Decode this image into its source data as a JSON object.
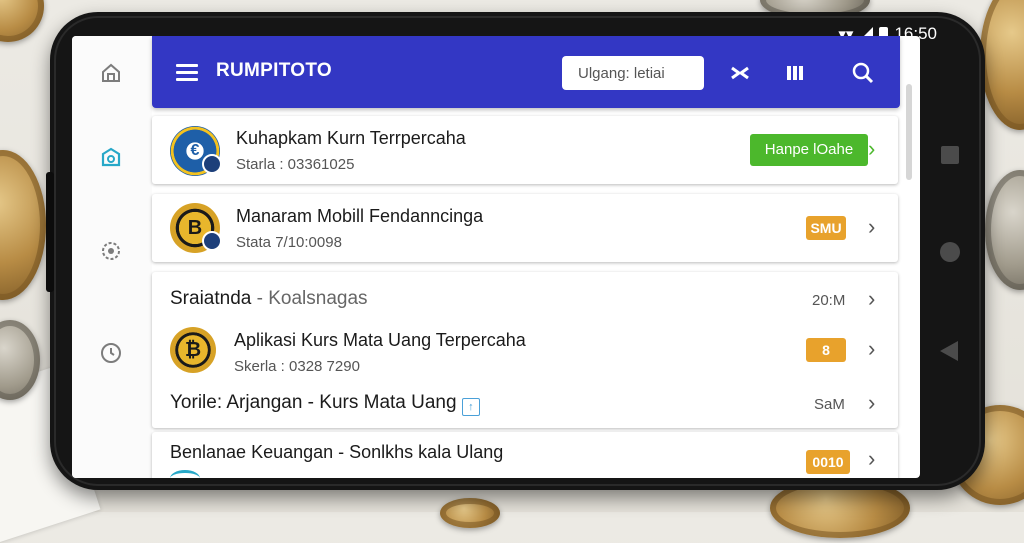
{
  "status_bar": {
    "time": "16:50"
  },
  "app_bar": {
    "title": "RUMPITOTO",
    "search_value": "Ulgang: letiai"
  },
  "items": [
    {
      "title": "Kuhapkam Kurn Terrpercaha",
      "subtitle": "Starla : 03361025",
      "action_label": "Hanpe lOahe"
    },
    {
      "title": "Manaram Mobill Fendanncinga",
      "subtitle": "Stata 7/10:0098",
      "badge": "SMU"
    }
  ],
  "section": {
    "title": "Sraiatnda",
    "subtitle": "Koalsnagas",
    "meta": "20:M",
    "rows": [
      {
        "title": "Aplikasi Kurs Mata Uang Terpercaha",
        "subtitle": "Skerla : 0328 7290",
        "badge": "8"
      },
      {
        "title": "Yorile: Arjangan - Kurs Mata Uang",
        "meta": "SaM"
      }
    ]
  },
  "last_item": {
    "title": "Benlanae Keuangan - Sonlkhs kala Ulang",
    "badge": "0010"
  },
  "colors": {
    "app_bar": "#3337c4",
    "action_green": "#4cb82c",
    "badge_orange": "#e8a22c",
    "rail_active": "#27a8c8"
  },
  "icons": {
    "rail": [
      "home-icon",
      "camera-icon",
      "settings-icon",
      "clock-icon"
    ],
    "app_bar": [
      "menu-icon",
      "search-icon",
      "swap-icon",
      "columns-icon"
    ],
    "nav": [
      "square-icon",
      "circle-icon",
      "back-triangle-icon"
    ]
  }
}
